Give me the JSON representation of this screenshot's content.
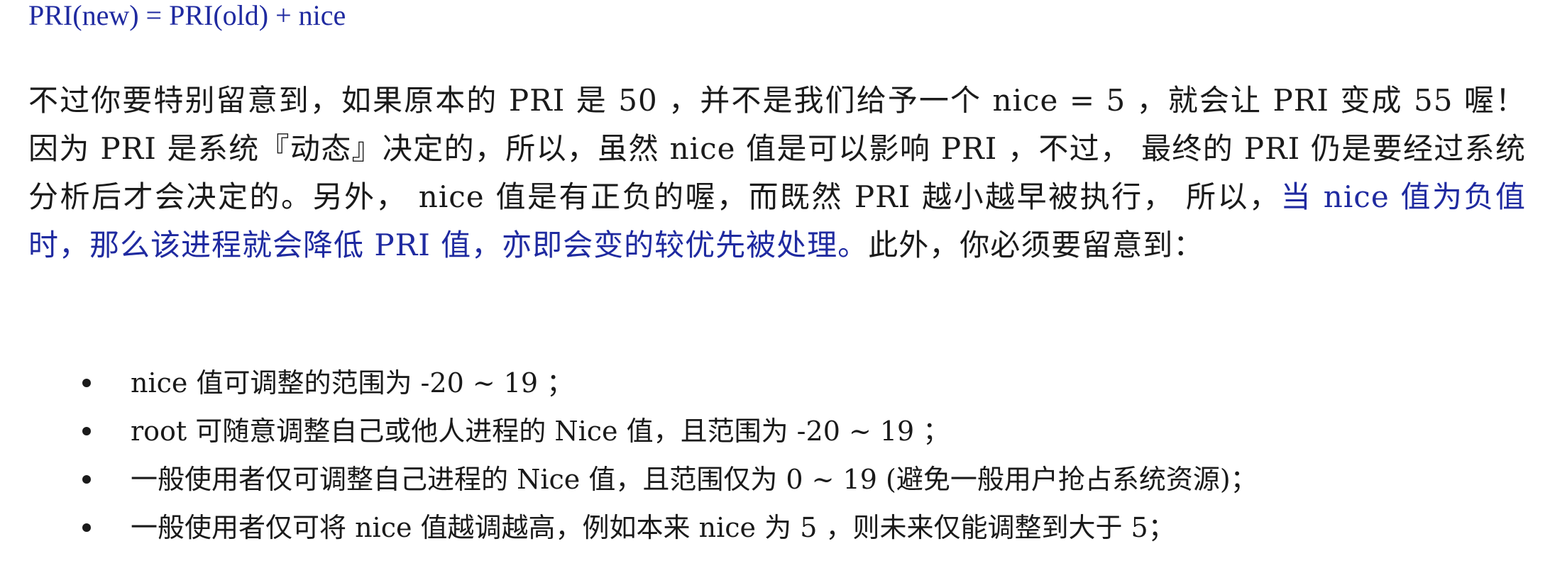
{
  "formula": "PRI(new) = PRI(old) + nice",
  "paragraph": {
    "part1": "不过你要特别留意到，如果原本的 PRI 是 50 ，并不是我们给予一个 nice = 5 ，就会让 PRI 变成 55 喔！ 因为 PRI 是系统『动态』决定的，所以，虽然 nice 值是可以影响 PRI ，不过， 最终的 PRI 仍是要经过系统分析后才会决定的。另外， nice 值是有正负的喔，而既然 PRI 越小越早被执行， 所以，",
    "highlight": "当 nice 值为负值时，那么该进程就会降低 PRI 值，亦即会变的较优先被处理。",
    "part2": "此外，你必须要留意到："
  },
  "bullets": [
    "nice 值可调整的范围为 -20 ~ 19 ；",
    "root 可随意调整自己或他人进程的 Nice 值，且范围为 -20 ~ 19 ；",
    "一般使用者仅可调整自己进程的 Nice 值，且范围仅为 0 ~ 19 (避免一般用户抢占系统资源)；",
    "一般使用者仅可将 nice 值越调越高，例如本来 nice 为 5 ，则未来仅能调整到大于 5；"
  ],
  "colors": {
    "highlight_blue": "#1f2aa0",
    "text": "#1a1a1a"
  }
}
